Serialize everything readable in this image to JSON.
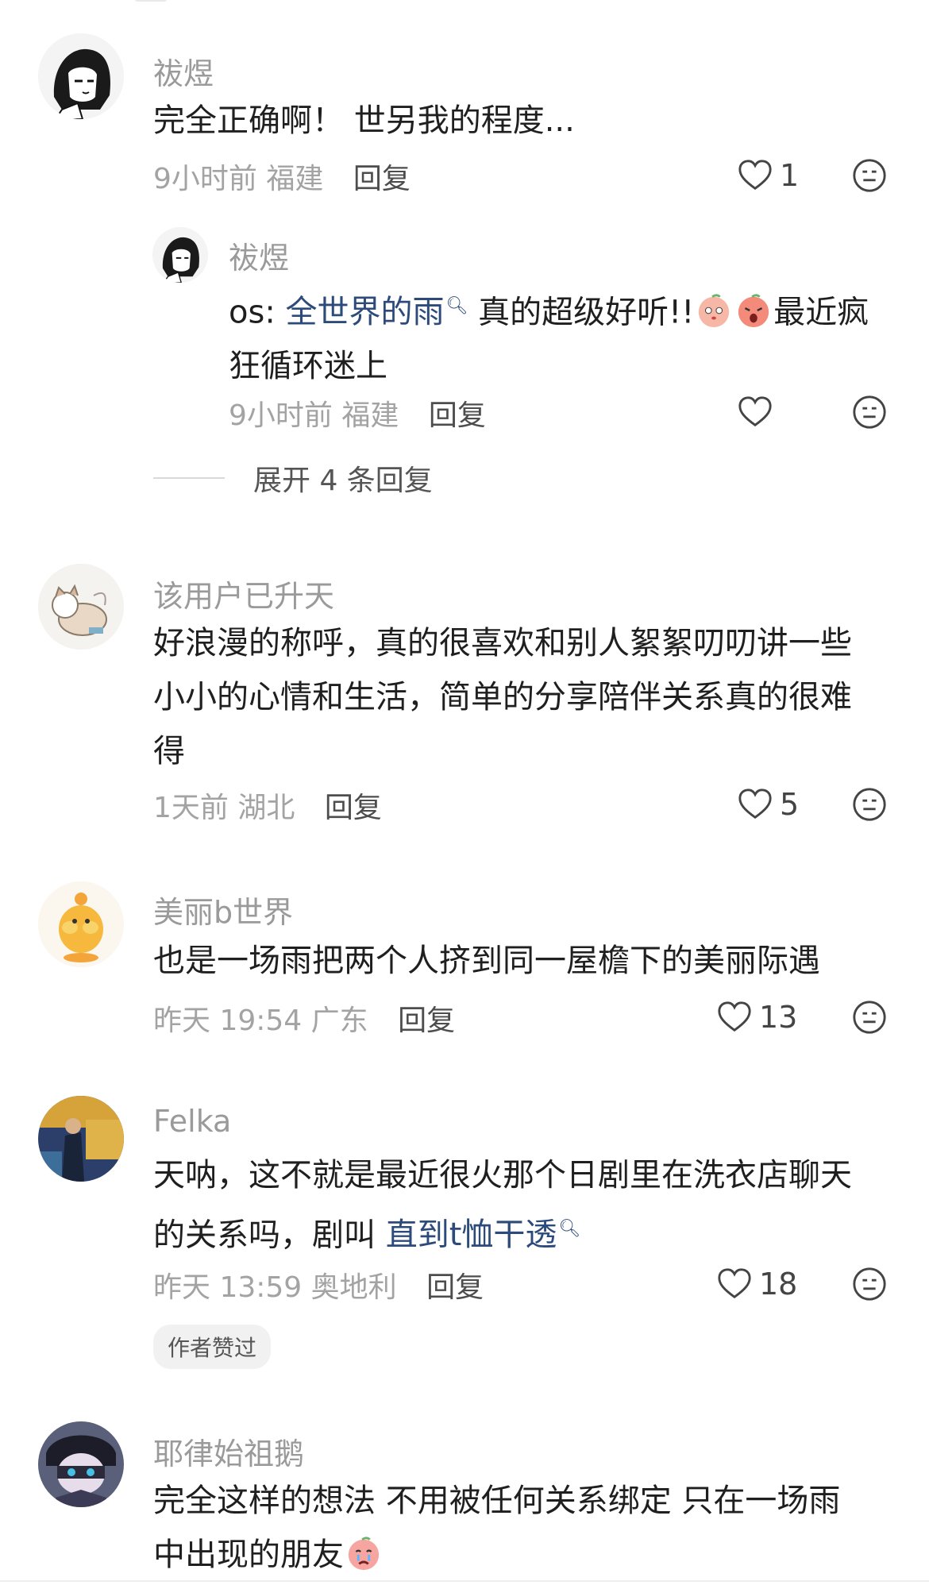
{
  "comments": [
    {
      "username": "祓煜",
      "content_lines": [
        "完全正确啊！ 世另我的程度..."
      ],
      "time": "9小时前",
      "location": "福建",
      "reply_label": "回复",
      "likes": "1",
      "avatar_icon": "anime-girl-avatar"
    },
    {
      "username": "祓煜",
      "content_prefix": "os: ",
      "content_link": "全世界的雨",
      "content_middle": " 真的超级好听!!",
      "content_suffix": "最近疯",
      "content_line2": "狂循环迷上",
      "time": "9小时前",
      "location": "福建",
      "reply_label": "回复",
      "likes": "",
      "avatar_icon": "anime-girl-avatar"
    },
    {
      "username": "该用户已升天",
      "content_lines": [
        "好浪漫的称呼，真的很喜欢和别人絮絮叨叨讲一些",
        "小小的心情和生活，简单的分享陪伴关系真的很难",
        "得"
      ],
      "time": "1天前",
      "location": "湖北",
      "reply_label": "回复",
      "likes": "5",
      "avatar_icon": "cat-avatar"
    },
    {
      "username": "美丽b世界",
      "content_lines": [
        "也是一场雨把两个人挤到同一屋檐下的美丽际遇"
      ],
      "time": "昨天 19:54",
      "location": "广东",
      "reply_label": "回复",
      "likes": "13",
      "avatar_icon": "duck-avatar"
    },
    {
      "username": "Felka",
      "content_line1": "天呐，这不就是最近很火那个日剧里在洗衣店聊天",
      "content_line2_prefix": "的关系吗，剧叫 ",
      "content_link": "直到t恤干透",
      "time": "昨天 13:59",
      "location": "奥地利",
      "reply_label": "回复",
      "likes": "18",
      "badge": "作者赞过",
      "avatar_icon": "painting-avatar"
    },
    {
      "username": "耶律始祖鹅",
      "content_lines": [
        "完全这样的想法 不用被任何关系绑定 只在一场雨",
        "中出现的朋友"
      ],
      "avatar_icon": "masked-character-avatar"
    }
  ],
  "expand": {
    "label": "展开 4 条回复"
  },
  "colors": {
    "username": "#9a9a9a",
    "link": "#2c4a7a",
    "meta": "#a3a3a3",
    "text": "#1f1f1f"
  }
}
